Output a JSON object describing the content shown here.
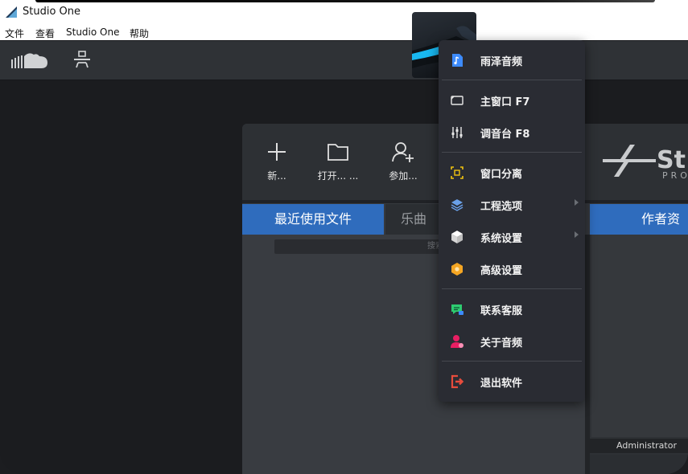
{
  "window": {
    "title": "Studio One"
  },
  "menubar": {
    "items": [
      "文件",
      "查看",
      "Studio One",
      "帮助"
    ]
  },
  "toolbar": {
    "icons": [
      "cloud-icon",
      "network-unplugged-icon"
    ]
  },
  "start_page": {
    "actions": [
      {
        "label": "新...",
        "icon": "plus-icon"
      },
      {
        "label": "打开... ...",
        "icon": "folder-icon"
      },
      {
        "label": "参加...",
        "icon": "add-user-icon"
      }
    ],
    "brand": {
      "text": "St",
      "sub": "PRO"
    },
    "tabs": {
      "recent": "最近使用文件",
      "songs": "乐曲",
      "author": "作者资料"
    },
    "search": {
      "placeholder": "搜索"
    },
    "author_user": "Administrator"
  },
  "context_menu": {
    "items": [
      {
        "label": "雨泽音频",
        "icon": "audio-file-icon",
        "color": "#3d8bfd"
      },
      {
        "label": "主窗口  F7",
        "icon": "window-icon"
      },
      {
        "label": "调音台  F8",
        "icon": "mixer-icon"
      },
      {
        "label": "窗口分离",
        "icon": "detach-icon",
        "color": "#f2c40f"
      },
      {
        "label": "工程选项",
        "icon": "layers-icon",
        "color": "#6aa0e8"
      },
      {
        "label": "系统设置",
        "icon": "cube-icon"
      },
      {
        "label": "高级设置",
        "icon": "hexagon-settings-icon",
        "color": "#f5a623"
      },
      {
        "label": "联系客服",
        "icon": "chat-support-icon",
        "color": "#2ecc71"
      },
      {
        "label": "关于音频",
        "icon": "user-info-icon",
        "color": "#e91e63"
      },
      {
        "label": "退出软件",
        "icon": "exit-icon",
        "color": "#e74c3c"
      }
    ]
  }
}
